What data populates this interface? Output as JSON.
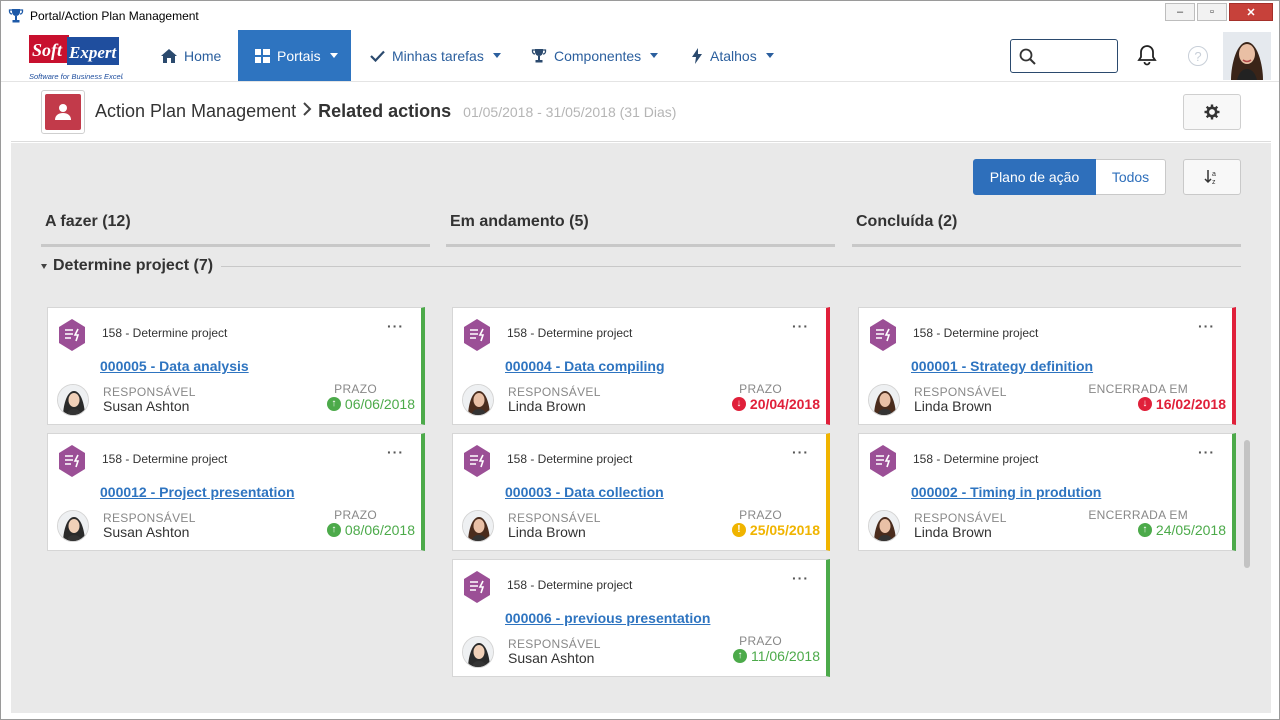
{
  "window": {
    "title": "Portal/Action Plan Management",
    "controls": [
      "minimize",
      "restore",
      "close"
    ]
  },
  "nav": {
    "logo_text": "SoftExpert",
    "logo_tagline": "Software for Business Excellence",
    "items": [
      {
        "label": "Home",
        "icon": "home-icon",
        "active": false,
        "dropdown": false
      },
      {
        "label": "Portais",
        "icon": "grid-icon",
        "active": true,
        "dropdown": true
      },
      {
        "label": "Minhas tarefas",
        "icon": "check-icon",
        "active": false,
        "dropdown": true
      },
      {
        "label": "Componentes",
        "icon": "trophy-icon",
        "active": false,
        "dropdown": true
      },
      {
        "label": "Atalhos",
        "icon": "bolt-icon",
        "active": false,
        "dropdown": true
      }
    ],
    "search_placeholder": "",
    "help_label": "?"
  },
  "header": {
    "module": "Action Plan Management",
    "current": "Related actions",
    "dates": "01/05/2018 - 31/05/2018 (31 Dias)"
  },
  "toolbar": {
    "view_options": [
      "Plano de ação",
      "Todos"
    ],
    "selected_view": "Plano de ação",
    "sort_label": "↓"
  },
  "columns": [
    {
      "title": "A fazer (12)"
    },
    {
      "title": "Em andamento (5)"
    },
    {
      "title": "Concluída (2)"
    }
  ],
  "group": {
    "label": "Determine project (7)"
  },
  "labels": {
    "responsible": "RESPONSÁVEL",
    "deadline": "PRAZO",
    "closed": "ENCERRADA EM"
  },
  "cards": [
    {
      "column": 0,
      "project": "158 - Determine project",
      "title": "000005 - Data analysis",
      "responsible": "Susan Ashton",
      "date_label": "PRAZO",
      "date": "06/06/2018",
      "status": "ok",
      "status_color": "#4caa4a"
    },
    {
      "column": 0,
      "project": "158 - Determine project",
      "title": "000012 - Project presentation",
      "responsible": "Susan Ashton",
      "date_label": "PRAZO",
      "date": "08/06/2018",
      "status": "ok",
      "status_color": "#4caa4a"
    },
    {
      "column": 1,
      "project": "158 - Determine project",
      "title": "000004 - Data compiling",
      "responsible": "Linda Brown",
      "date_label": "PRAZO",
      "date": "20/04/2018",
      "status": "late",
      "status_color": "#e0203a"
    },
    {
      "column": 1,
      "project": "158 - Determine project",
      "title": "000003 - Data collection",
      "responsible": "Linda Brown",
      "date_label": "PRAZO",
      "date": "25/05/2018",
      "status": "warn",
      "status_color": "#f0b400"
    },
    {
      "column": 1,
      "project": "158 - Determine project",
      "title": "000006 - previous presentation",
      "responsible": "Susan Ashton",
      "date_label": "PRAZO",
      "date": "11/06/2018",
      "status": "ok",
      "status_color": "#4caa4a"
    },
    {
      "column": 2,
      "project": "158 - Determine project",
      "title": "000001 - Strategy definition",
      "responsible": "Linda Brown",
      "date_label": "ENCERRADA EM",
      "date": "16/02/2018",
      "status": "late",
      "status_color": "#e0203a"
    },
    {
      "column": 2,
      "project": "158 - Determine project",
      "title": "000002 - Timing in prodution",
      "responsible": "Linda Brown",
      "date_label": "ENCERRADA EM",
      "date": "24/05/2018",
      "status": "ok",
      "status_color": "#4caa4a"
    }
  ],
  "colors": {
    "accent": "#2e74c0",
    "ok": "#4caa4a",
    "late": "#e0203a",
    "warn": "#f0b400",
    "card_icon": "#9b4f96"
  }
}
